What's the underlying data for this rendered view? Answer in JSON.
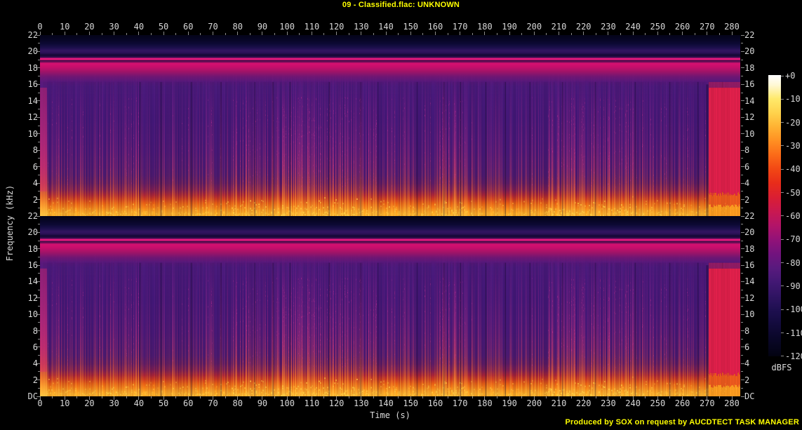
{
  "window": {
    "title": "09 - Classified.flac: UNKNOWN",
    "footer_credit": "Produced by SOX on request by AUCDTECT TASK MANAGER",
    "bg_color": "#000000",
    "accent_text_color": "#ffff00"
  },
  "axes": {
    "x_label": "Time (s)",
    "y_label": "Frequency (kHz)",
    "x_ticks": [
      "0",
      "10",
      "20",
      "30",
      "40",
      "50",
      "60",
      "70",
      "80",
      "90",
      "100",
      "110",
      "120",
      "130",
      "140",
      "150",
      "160",
      "170",
      "180",
      "190",
      "200",
      "210",
      "220",
      "230",
      "240",
      "250",
      "260",
      "270",
      "280"
    ],
    "y_ticks_channel1": [
      "22",
      "20",
      "18",
      "16",
      "14",
      "12",
      "10",
      "8",
      "6",
      "4",
      "2"
    ],
    "y_ticks_channel2": [
      "22",
      "20",
      "18",
      "16",
      "14",
      "12",
      "10",
      "8",
      "6",
      "4",
      "2",
      "DC"
    ],
    "tick_text_color": "#d8d8d8",
    "tick_mark_color": "#8a8a8a"
  },
  "colorbar": {
    "labels": [
      "+0",
      "-10",
      "-20",
      "-30",
      "-40",
      "-50",
      "-60",
      "-70",
      "-80",
      "-90",
      "-100",
      "-110",
      "-120"
    ],
    "unit_label": "dBFS"
  },
  "chart_data": {
    "type": "heatmap",
    "subtype": "stereo-audio-spectrogram",
    "title": "09 - Classified.flac: UNKNOWN",
    "generator": "SOX",
    "channels": 2,
    "x_axis": {
      "label": "Time (s)",
      "min": 0,
      "max": 283.4,
      "tick_interval_s": 10,
      "minor_tick_s": 5
    },
    "y_axis": {
      "label": "Frequency (kHz)",
      "min": 0,
      "min_label": "DC",
      "max": 22,
      "tick_interval_khz": 2
    },
    "z_axis": {
      "label": "dBFS",
      "min": -120,
      "max": 0,
      "tick_interval_db": 10
    },
    "colormap_db_stops": [
      [
        0,
        "#ffffff"
      ],
      [
        -4,
        "#fff8d6"
      ],
      [
        -10,
        "#ffe96a"
      ],
      [
        -16,
        "#ffd24c"
      ],
      [
        -22,
        "#ffb232"
      ],
      [
        -28,
        "#ff8f22"
      ],
      [
        -34,
        "#fb6a18"
      ],
      [
        -40,
        "#f24714"
      ],
      [
        -46,
        "#e82c1a"
      ],
      [
        -52,
        "#da1e33"
      ],
      [
        -58,
        "#c91850"
      ],
      [
        -64,
        "#b31468"
      ],
      [
        -70,
        "#921278"
      ],
      [
        -76,
        "#73137e"
      ],
      [
        -82,
        "#591a7e"
      ],
      [
        -88,
        "#431874"
      ],
      [
        -94,
        "#301463"
      ],
      [
        -100,
        "#1e0f50"
      ],
      [
        -106,
        "#130b3d"
      ],
      [
        -112,
        "#0a0729"
      ],
      [
        -118,
        "#040417"
      ],
      [
        -120,
        "#02020f"
      ]
    ],
    "spectral_profile_khz_color": [
      [
        0,
        "#f9a41e"
      ],
      [
        0.3,
        "#ffae26"
      ],
      [
        0.7,
        "#fb9a1e"
      ],
      [
        1.1,
        "#f57d16"
      ],
      [
        1.6,
        "#e65d14"
      ],
      [
        2.1,
        "#cc3a20"
      ],
      [
        2.6,
        "#a82438"
      ],
      [
        3.2,
        "#7c1e52"
      ],
      [
        4,
        "#5c1b64"
      ],
      [
        5,
        "#4c1a70"
      ],
      [
        8,
        "#471876"
      ],
      [
        12,
        "#441878"
      ],
      [
        15.8,
        "#4a1a7c"
      ],
      [
        16.4,
        "#55187a"
      ],
      [
        17,
        "#6f1672"
      ],
      [
        17.6,
        "#a01468"
      ],
      [
        18.2,
        "#c80e6c"
      ],
      [
        18.6,
        "#d41070"
      ],
      [
        18.8,
        "#6a0e56"
      ],
      [
        18.95,
        "#3a0a44"
      ],
      [
        19.05,
        "#e2187c"
      ],
      [
        19.2,
        "#e2187c"
      ],
      [
        19.35,
        "#350c4e"
      ],
      [
        19.6,
        "#140834"
      ],
      [
        19.9,
        "#2c1158"
      ],
      [
        20.15,
        "#321560"
      ],
      [
        20.5,
        "#1c104c"
      ],
      [
        21,
        "#0c0934"
      ],
      [
        21.6,
        "#060522"
      ],
      [
        22,
        "#04041a"
      ]
    ],
    "events": {
      "intro_burst_s": [
        0,
        2.8
      ],
      "watermark_line_khz": 19.1,
      "pink_band_khz": [
        17.5,
        18.8
      ],
      "outro_block": {
        "start_s": 270.5,
        "end_s": 283.4,
        "top_khz": 15.6,
        "color_main": "#e1204b",
        "color_low": "#ee5a1e",
        "color_bottom": "#fe9d20"
      },
      "loud_sections_s": [
        [
          26,
          40
        ],
        [
          78,
          136
        ],
        [
          158,
          178
        ],
        [
          205,
          241
        ]
      ],
      "quiet_sections_s": [
        [
          40,
          53
        ],
        [
          178,
          205
        ],
        [
          241,
          262
        ]
      ]
    },
    "render": {
      "seed": 1337,
      "segments": [
        [
          0,
          2.8,
          0,
          0
        ],
        [
          2.8,
          8,
          0.55,
          0.62
        ],
        [
          8,
          26,
          0.5,
          0.55
        ],
        [
          26,
          40,
          0.62,
          0.7
        ],
        [
          40,
          53,
          0.42,
          0.46
        ],
        [
          53,
          78,
          0.52,
          0.56
        ],
        [
          78,
          136,
          0.68,
          0.78
        ],
        [
          136,
          158,
          0.5,
          0.55
        ],
        [
          158,
          178,
          0.64,
          0.72
        ],
        [
          178,
          205,
          0.46,
          0.5
        ],
        [
          205,
          241,
          0.7,
          0.8
        ],
        [
          241,
          262,
          0.52,
          0.56
        ],
        [
          262,
          270.5,
          0.45,
          0.5
        ]
      ],
      "streak_ramp": [
        [
          17.5,
          180,
          30,
          150,
          0
        ],
        [
          16,
          190,
          35,
          150,
          0.1
        ],
        [
          13,
          205,
          45,
          150,
          0.3
        ],
        [
          9,
          220,
          55,
          140,
          0.5
        ],
        [
          6,
          235,
          65,
          115,
          0.65
        ],
        [
          4,
          242,
          90,
          70,
          0.75
        ],
        [
          2.5,
          250,
          130,
          45,
          0.85
        ],
        [
          1,
          255,
          175,
          55,
          0.95
        ],
        [
          0,
          255,
          200,
          70,
          1
        ]
      ],
      "speckle_color": "#ffd246",
      "dot_color_rgb": [
        210,
        55,
        150
      ]
    }
  }
}
